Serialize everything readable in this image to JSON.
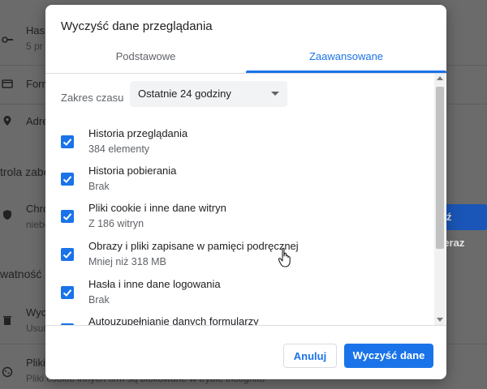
{
  "background": {
    "items": [
      {
        "label": "Has",
        "sub": "5 pr"
      },
      {
        "label": "Form"
      },
      {
        "label": "Adre"
      },
      {
        "label": "Chro",
        "sub": "niebe"
      },
      {
        "label": "Wycz",
        "sub": "Usun"
      },
      {
        "label": "Pliki",
        "sub": "Pliki cookie innych firm są blokowane w trybie incognito"
      }
    ],
    "sections": [
      "trola zabe",
      "watność i"
    ],
    "action_button": "dź teraz"
  },
  "dialog": {
    "title": "Wyczyść dane przeglądania",
    "tabs": [
      {
        "label": "Podstawowe",
        "selected": false
      },
      {
        "label": "Zaawansowane",
        "selected": true
      }
    ],
    "time_range": {
      "label": "Zakres czasu",
      "value": "Ostatnie 24 godziny"
    },
    "options": [
      {
        "title": "Historia przeglądania",
        "sub": "384 elementy",
        "checked": true
      },
      {
        "title": "Historia pobierania",
        "sub": "Brak",
        "checked": true
      },
      {
        "title": "Pliki cookie i inne dane witryn",
        "sub": "Z 186 witryn",
        "checked": true
      },
      {
        "title": "Obrazy i pliki zapisane w pamięci podręcznej",
        "sub": "Mniej niż 318 MB",
        "checked": true
      },
      {
        "title": "Hasła i inne dane logowania",
        "sub": "Brak",
        "checked": true
      },
      {
        "title": "Autouzupełnianie danych formularzy",
        "sub": "",
        "checked": true
      }
    ],
    "cancel_label": "Anuluj",
    "clear_label": "Wyczyść dane"
  },
  "colors": {
    "accent": "#1a73e8",
    "overlay": "#6b6b6b"
  }
}
